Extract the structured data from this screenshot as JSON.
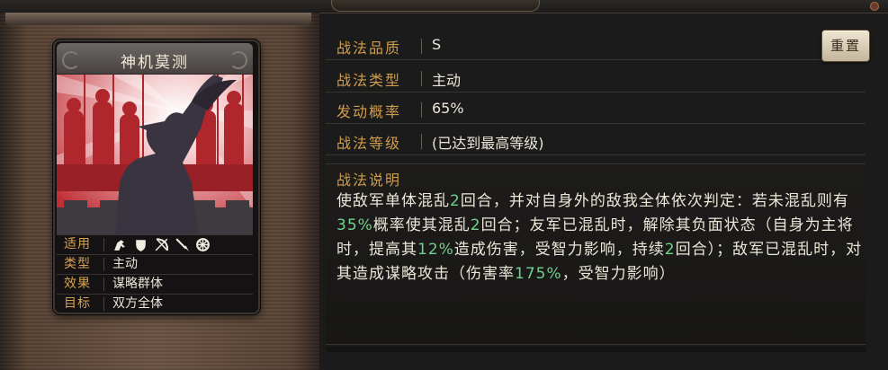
{
  "card": {
    "title": "神机莫测",
    "rows": [
      {
        "key": "适用",
        "type": "icons"
      },
      {
        "key": "类型",
        "value": "主动"
      },
      {
        "key": "效果",
        "value": "谋略群体"
      },
      {
        "key": "目标",
        "value": "双方全体"
      }
    ],
    "usage_icons": [
      "cavalry-icon",
      "shield-icon",
      "bow-icon",
      "spear-icon",
      "wheel-icon"
    ]
  },
  "props": [
    {
      "key": "战法品质",
      "value": "S"
    },
    {
      "key": "战法类型",
      "value": "主动"
    },
    {
      "key": "发动概率",
      "value": "65%"
    },
    {
      "key": "战法等级",
      "value": "(已达到最高等级)"
    }
  ],
  "reset_label": "重置",
  "description": {
    "title": "战法说明",
    "segments": [
      {
        "text": "使敌军单体混乱"
      },
      {
        "text": "2",
        "hl": true
      },
      {
        "text": "回合，并对自身外的敌我全体依次判定：若未混乱则有"
      },
      {
        "text": "35%",
        "hl": true
      },
      {
        "text": "概率使其混乱"
      },
      {
        "text": "2",
        "hl": true
      },
      {
        "text": "回合；友军已混乱时，解除其负面状态（自身为主将时，提高其"
      },
      {
        "text": "12%",
        "hl": true
      },
      {
        "text": "造成伤害，受智力影响，持续"
      },
      {
        "text": "2",
        "hl": true
      },
      {
        "text": "回合）；敌军已混乱时，对其造成谋略攻击（伤害率"
      },
      {
        "text": "175%",
        "hl": true
      },
      {
        "text": "，受智力影响）"
      }
    ]
  },
  "colors": {
    "label_gold": "#cf9d4e",
    "highlight_green": "#6fd18b",
    "art_red": "#c7333a"
  }
}
